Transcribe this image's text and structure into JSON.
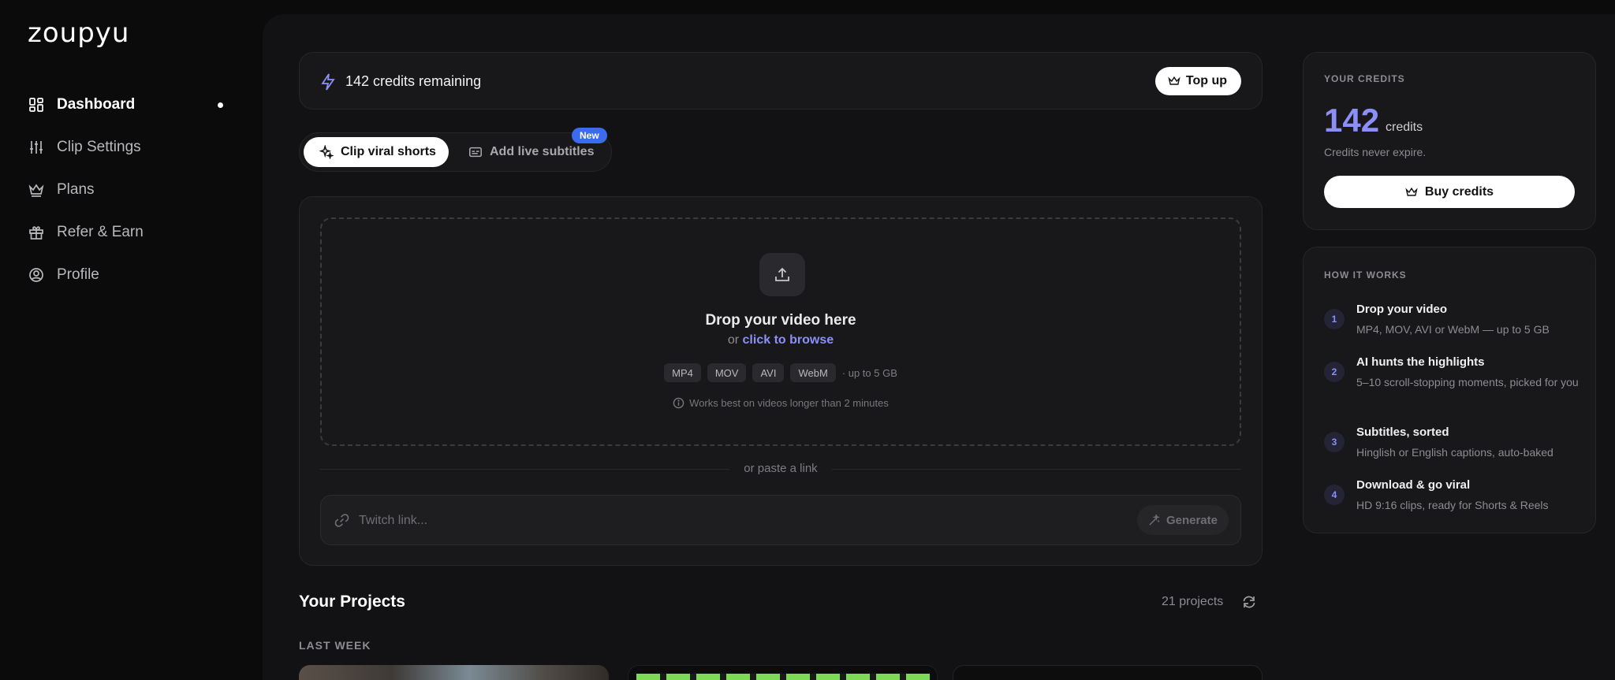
{
  "app": {
    "logo": "zoupyu"
  },
  "sidebar": {
    "items": [
      {
        "label": "Dashboard",
        "icon": "dashboard-icon",
        "active": true
      },
      {
        "label": "Clip Settings",
        "icon": "sliders-icon",
        "active": false
      },
      {
        "label": "Plans",
        "icon": "crown-icon",
        "active": false
      },
      {
        "label": "Refer & Earn",
        "icon": "gift-icon",
        "active": false
      },
      {
        "label": "Profile",
        "icon": "user-circle-icon",
        "active": false
      }
    ]
  },
  "credits_bar": {
    "text": "142 credits remaining",
    "topup_label": "Top up",
    "icon": "bolt-icon"
  },
  "tabs": {
    "clip": "Clip viral shorts",
    "subtitles": "Add live subtitles",
    "new_badge": "New"
  },
  "upload": {
    "title": "Drop your video here",
    "or_text": "or ",
    "browse_label": "click to browse",
    "formats": [
      "MP4",
      "MOV",
      "AVI",
      "WebM"
    ],
    "format_note": "· up to 5 GB",
    "hint": "Works best on videos longer than 2 minutes",
    "divider_text": "or paste a link",
    "link_placeholder": "Twitch link...",
    "generate_label": "Generate"
  },
  "projects": {
    "title": "Your Projects",
    "count": "21 projects",
    "section": "LAST WEEK"
  },
  "your_credits": {
    "label": "YOUR CREDITS",
    "amount": "142",
    "unit": "credits",
    "note": "Credits never expire.",
    "buy_label": "Buy credits"
  },
  "how_it_works": {
    "label": "HOW IT WORKS",
    "steps": [
      {
        "num": "1",
        "title": "Drop your video",
        "desc": "MP4, MOV, AVI or WebM — up to 5 GB"
      },
      {
        "num": "2",
        "title": "AI hunts the highlights",
        "desc": "5–10 scroll-stopping moments, picked for you"
      },
      {
        "num": "3",
        "title": "Subtitles, sorted",
        "desc": "Hinglish or English captions, auto-baked"
      },
      {
        "num": "4",
        "title": "Download & go viral",
        "desc": "HD 9:16 clips, ready for Shorts & Reels"
      }
    ]
  },
  "colors": {
    "accent": "#8b8ff7",
    "badge": "#3b6cf0",
    "panel": "#18181a"
  }
}
